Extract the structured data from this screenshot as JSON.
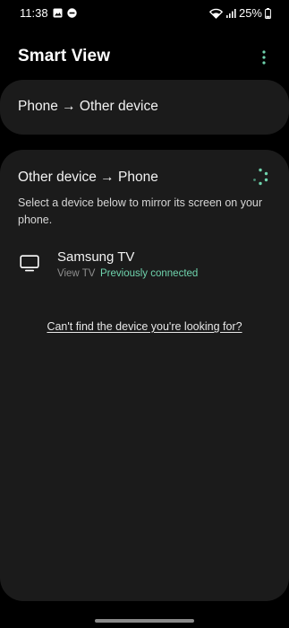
{
  "status_bar": {
    "time": "11:38",
    "battery": "25%",
    "icons": [
      "gallery-notification-icon",
      "minus-circle-icon",
      "wifi-icon",
      "signal-icon",
      "battery-icon"
    ]
  },
  "header": {
    "title": "Smart View",
    "more_icon": "more-vertical-icon"
  },
  "phone_to_other": {
    "title": "Phone → Other device"
  },
  "other_to_phone": {
    "title": "Other device → Phone",
    "description": "Select a device below to mirror its screen on your phone.",
    "devices": [
      {
        "name": "Samsung TV",
        "type": "View TV",
        "status": "Previously connected",
        "icon": "tv-icon"
      }
    ],
    "help_link": "Can't find the device you're looking for?"
  },
  "colors": {
    "background": "#000000",
    "card": "#1b1b1b",
    "accent": "#6fd3ad",
    "secondary_text": "#8e8e8e"
  }
}
